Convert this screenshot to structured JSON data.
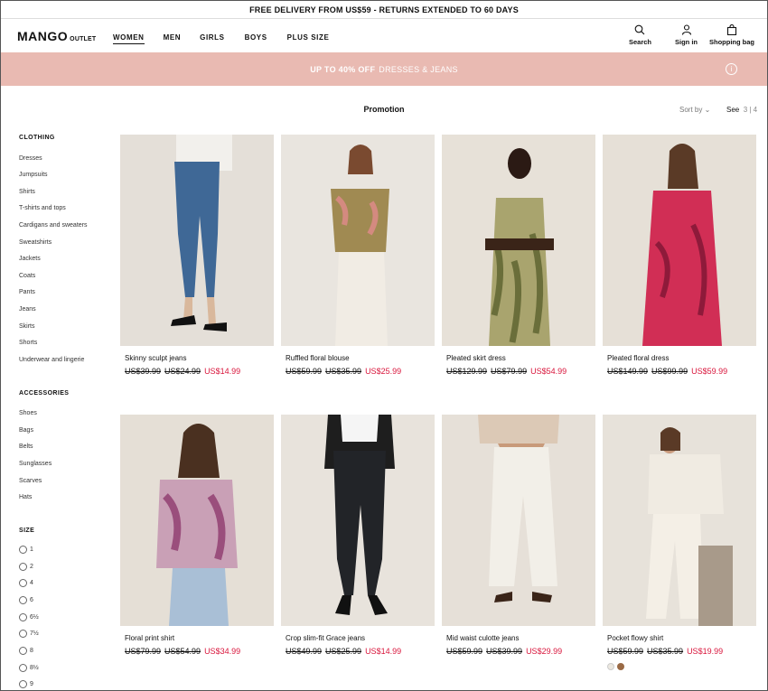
{
  "topbar": {
    "text": "FREE DELIVERY FROM US$59 - RETURNS EXTENDED TO 60 DAYS"
  },
  "header": {
    "logo": "MANGO",
    "logo_sub": "OUTLET",
    "nav": [
      "WOMEN",
      "MEN",
      "GIRLS",
      "BOYS",
      "PLUS SIZE"
    ],
    "icons": {
      "search": "Search",
      "signin": "Sign in",
      "bag": "Shopping bag"
    }
  },
  "promo": {
    "bold": "UP TO 40% OFF",
    "rest": "DRESSES & JEANS",
    "info": "i",
    "color": "#e9bab2"
  },
  "page": {
    "title": "Promotion",
    "sort": "Sort by",
    "see": "See",
    "grid_options": "3 | 4"
  },
  "sidebar": {
    "clothing_title": "CLOTHING",
    "clothing": [
      "Dresses",
      "Jumpsuits",
      "Shirts",
      "T-shirts and tops",
      "Cardigans and sweaters",
      "Sweatshirts",
      "Jackets",
      "Coats",
      "Pants",
      "Jeans",
      "Skirts",
      "Shorts",
      "Underwear and lingerie"
    ],
    "accessories_title": "ACCESSORIES",
    "accessories": [
      "Shoes",
      "Bags",
      "Belts",
      "Sunglasses",
      "Scarves",
      "Hats"
    ],
    "size_title": "SIZE",
    "sizes": [
      "1",
      "2",
      "4",
      "6",
      "6½",
      "7½",
      "8",
      "8½",
      "9"
    ]
  },
  "products": [
    {
      "name": "Skinny sculpt jeans",
      "old1": "US$39.99",
      "old2": "US$24.99",
      "price": "US$14.99"
    },
    {
      "name": "Ruffled floral blouse",
      "old1": "US$59.99",
      "old2": "US$35.99",
      "price": "US$25.99"
    },
    {
      "name": "Pleated skirt dress",
      "old1": "US$129.99",
      "old2": "US$79.99",
      "price": "US$54.99"
    },
    {
      "name": "Pleated floral dress",
      "old1": "US$149.99",
      "old2": "US$99.99",
      "price": "US$59.99"
    },
    {
      "name": "Floral print shirt",
      "old1": "US$79.99",
      "old2": "US$54.99",
      "price": "US$34.99"
    },
    {
      "name": "Crop slim-fit Grace jeans",
      "old1": "US$49.99",
      "old2": "US$25.99",
      "price": "US$14.99"
    },
    {
      "name": "Mid waist culotte jeans",
      "old1": "US$59.99",
      "old2": "US$39.99",
      "price": "US$29.99"
    },
    {
      "name": "Pocket flowy shirt",
      "old1": "US$59.99",
      "old2": "US$35.99",
      "price": "US$19.99"
    }
  ],
  "colors": {
    "sale": "#d9163c",
    "promo": "#e9bab2"
  },
  "swatch_colors": [
    "#ece8e0",
    "#9a6a45"
  ]
}
